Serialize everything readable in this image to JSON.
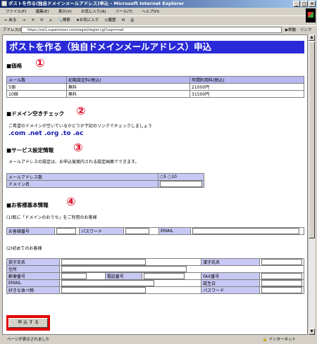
{
  "window": {
    "title": "ポストを作る(独自ドメインメールアドレス)申込 - Microsoft Internet Explorer",
    "buttons": [
      "_",
      "□",
      "×"
    ]
  },
  "menu": [
    "ファイル(F)",
    "編集(E)",
    "表示(V)",
    "お気に入り(A)",
    "ツール(T)",
    "ヘルプ(H)"
  ],
  "toolbar": {
    "back": "戻る",
    "search": "検索",
    "favorites": "お気に入り",
    "history": "履歴"
  },
  "address": {
    "label": "アドレス(D)",
    "url": "https://ssl1.supermoon.com/regist/regist.cgi?usp=mail",
    "go": "移動",
    "links": "リンク"
  },
  "page": {
    "banner": "ポストを作る（独自ドメインメールアドレス）申込",
    "sections": {
      "price": {
        "title": "■価格",
        "num": "①"
      },
      "domain_check": {
        "title": "■ドメイン空きチェック",
        "num": "②"
      },
      "service": {
        "title": "■サービス設定情報",
        "num": "③"
      },
      "customer": {
        "title": "■お客様基本情報",
        "num": "④"
      }
    },
    "price_table": {
      "headers": [
        "メール数",
        "初期設定料(税込)",
        "年間利用料(税込)"
      ],
      "rows": [
        [
          "5個",
          "無料",
          "21000円"
        ],
        [
          "10個",
          "無料",
          "31500円"
        ]
      ]
    },
    "domain_desc": "ご希望のドメインが空いているかどうか下記のリンクでチェックしましょう",
    "domain_links": [
      ".com",
      ".net",
      ".org",
      ".to",
      ".ac"
    ],
    "service_desc": "メールアドレスの設定は、お申込後案内される設定画面でできます。",
    "service_table": {
      "count_label": "メールアドレス数",
      "radio_5": "5",
      "radio_10": "10",
      "domain_label": "ドメイン名"
    },
    "existing": {
      "heading": "(1)既に「ドメインのおうち」をご利用のお客様",
      "customer_no": "お客様番号",
      "password": "パスワード",
      "email": "EMAIL"
    },
    "new_customer": {
      "heading": "(2)初めてのお客様",
      "name_en": "英字氏名",
      "name_kanji": "漢字氏名",
      "address": "住所",
      "zip": "郵便番号",
      "phone": "電話番号",
      "fax": "FAX番号",
      "email": "EMAIL",
      "birthday": "誕生日",
      "food": "好きな食べ物",
      "password": "パスワード"
    },
    "submit": "申 込 す る"
  },
  "status": {
    "left": "ページが表示されました",
    "right": "インターネット"
  }
}
